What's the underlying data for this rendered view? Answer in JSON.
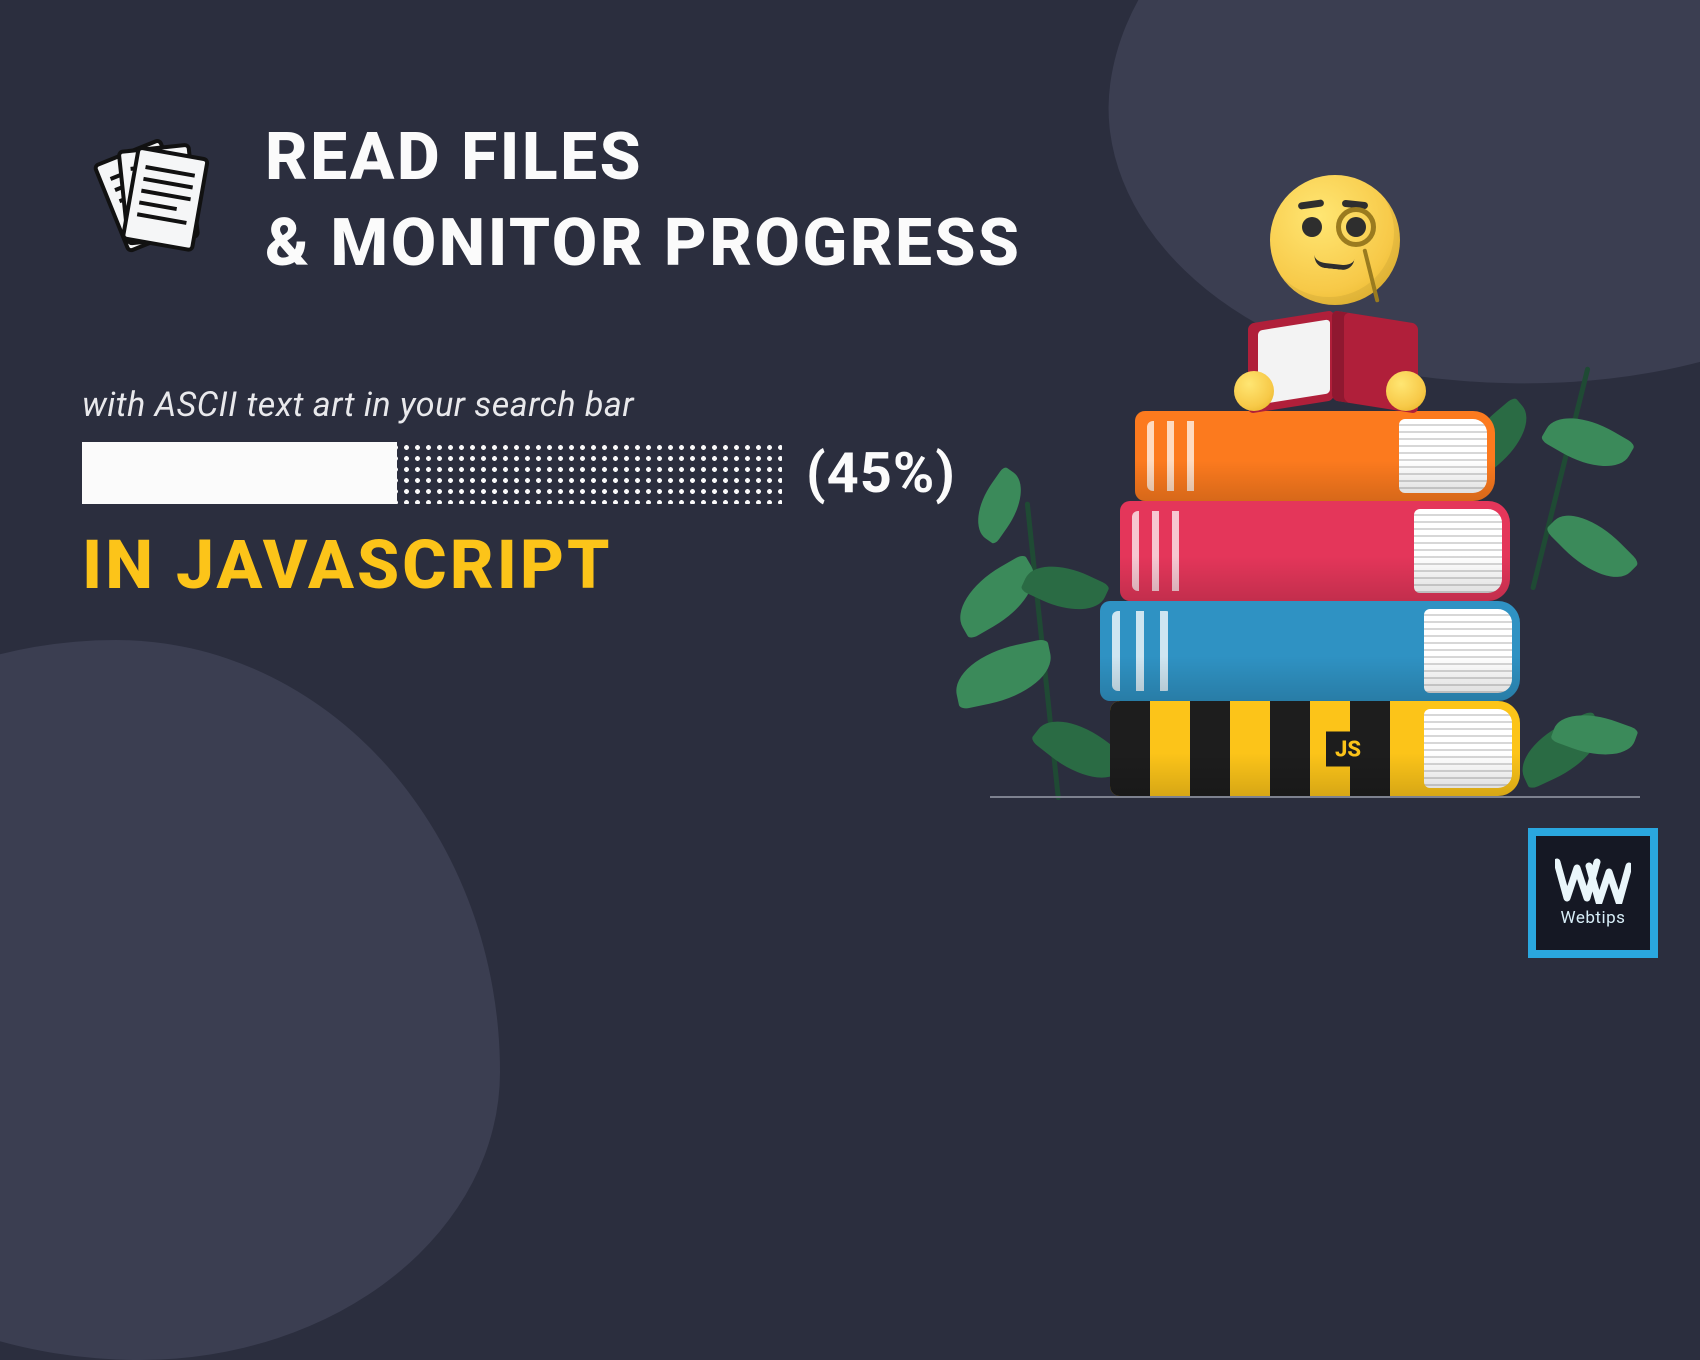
{
  "heading_line1": "READ FILES",
  "heading_line2": "& MONITOR PROGRESS",
  "subtitle": "with ASCII text art in your search bar",
  "progress": {
    "percent": 45,
    "label": "(45%)"
  },
  "in_js": "IN JAVASCRIPT",
  "book_js_tag": "JS",
  "badge": {
    "label": "Webtips"
  },
  "colors": {
    "bg": "#2b2e3e",
    "blob": "#3b3e51",
    "fg": "#fbfbfb",
    "accent": "#fcc419",
    "badge_border": "#2aa7df"
  }
}
